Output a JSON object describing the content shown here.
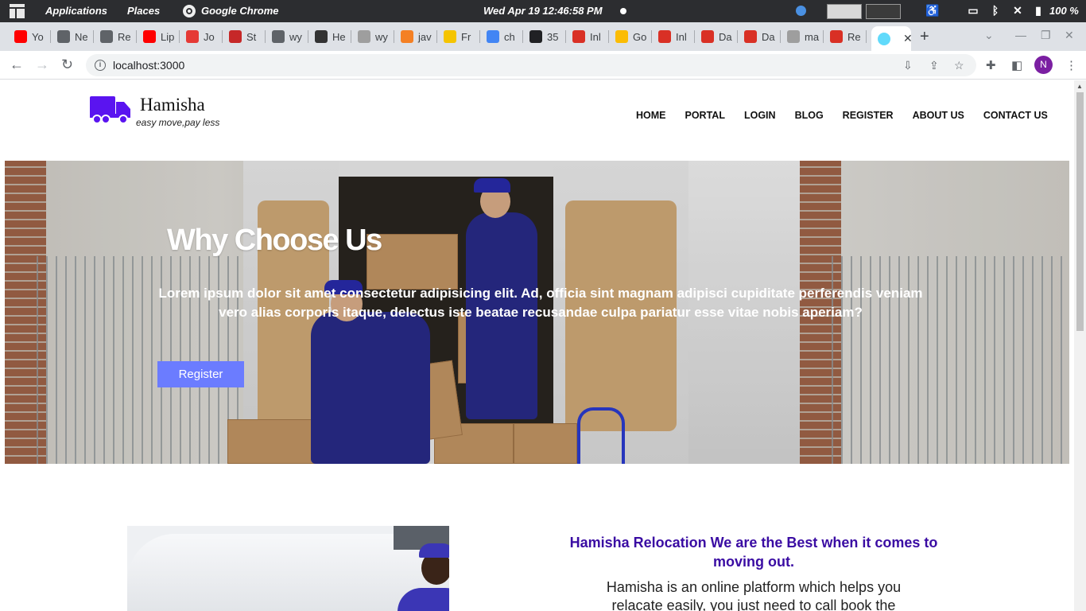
{
  "os_panel": {
    "applications": "Applications",
    "places": "Places",
    "browser": "Google Chrome",
    "clock": "Wed Apr 19  12:46:58 PM",
    "battery": "100 %"
  },
  "browser": {
    "tabs": [
      {
        "label": "Yo",
        "color": "#ff0000"
      },
      {
        "label": "Ne",
        "color": "#5f6368"
      },
      {
        "label": "Re",
        "color": "#5f6368"
      },
      {
        "label": "Lip",
        "color": "#ff0000"
      },
      {
        "label": "Jo",
        "color": "#e53935"
      },
      {
        "label": "St",
        "color": "#c62828"
      },
      {
        "label": "wy",
        "color": "#5f6368"
      },
      {
        "label": "He",
        "color": "#333333"
      },
      {
        "label": "wy",
        "color": "#9e9e9e"
      },
      {
        "label": "jav",
        "color": "#f48024"
      },
      {
        "label": "Fr",
        "color": "#f5c400"
      },
      {
        "label": "ch",
        "color": "#4285f4"
      },
      {
        "label": "35",
        "color": "#202124"
      },
      {
        "label": "Inl",
        "color": "#d93025"
      },
      {
        "label": "Go",
        "color": "#fbbc04"
      },
      {
        "label": "Inl",
        "color": "#d93025"
      },
      {
        "label": "Da",
        "color": "#d93025"
      },
      {
        "label": "Da",
        "color": "#d93025"
      },
      {
        "label": "ma",
        "color": "#9e9e9e"
      },
      {
        "label": "Re",
        "color": "#d93025"
      }
    ],
    "active_tab_close": "✕",
    "new_tab": "+",
    "url": "localhost:3000",
    "profile_initial": "N",
    "profile_color": "#7b1fa2"
  },
  "site": {
    "brand": "Hamisha",
    "tagline": "easy move,pay less",
    "brand_color": "#5a14f0",
    "nav": [
      "HOME",
      "PORTAL",
      "LOGIN",
      "BLOG",
      "REGISTER",
      "ABOUT US",
      "CONTACT US"
    ],
    "hero": {
      "title": "Why Choose Us",
      "text": "Lorem ipsum dolor sit amet consectetur adipisicing elit. Ad, officia sint magnam adipisci cupiditate perferendis veniam vero alias corporis itaque, delectus iste beatae recusandae culpa pariatur esse vitae nobis aperiam?",
      "button": "Register",
      "button_color": "#6b7cff"
    },
    "about": {
      "title": "Hamisha Relocation We are the Best when it comes to moving out.",
      "text": "Hamisha is an online platform which helps you relacate easily, you just need to call book the",
      "title_color": "#3a0ca3"
    }
  }
}
